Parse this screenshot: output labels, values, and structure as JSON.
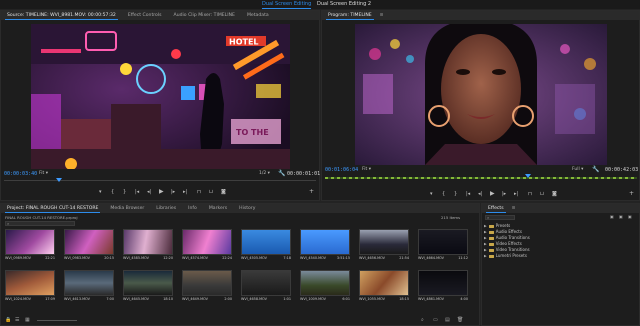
{
  "workspace_tabs": [
    "Dual Screen Editing",
    "Dual Screen Editing 2"
  ],
  "source_panel": {
    "tabs": [
      "Source: TIMELINE: WVI_8981.MOV: 00:00:57:32",
      "Effect Controls",
      "Audio Clip Mixer: TIMELINE",
      "Metadata"
    ],
    "timecode_left": "00:00:03:40",
    "timecode_right": "00:00:01:01",
    "fit_label": "Fit",
    "fraction_label": "1/2"
  },
  "program_panel": {
    "tabs": [
      "Program: TIMELINE"
    ],
    "timecode_left": "00:01:06:04",
    "timecode_right": "00:00:42:03",
    "fit_label": "Fit",
    "quality_label": "Full"
  },
  "project_panel": {
    "tabs": [
      "Project: FINAL ROUGH CUT-14 RESTORE",
      "Media Browser",
      "Libraries",
      "Info",
      "Markers",
      "History"
    ],
    "path": "FINAL ROUGH CUT-14 RESTORE.prproj",
    "items_count": "215 Items",
    "clips": [
      {
        "name": "WVI_0989.MOV",
        "dur": "22:21"
      },
      {
        "name": "WVI_0983.MOV",
        "dur": "20:15"
      },
      {
        "name": "WVI_4585.MOV",
        "dur": "12:20"
      },
      {
        "name": "WVI_4574.MOV",
        "dur": "22:24"
      },
      {
        "name": "WVI_4505.MOV",
        "dur": "7:18"
      },
      {
        "name": "WVI_4540.MOV",
        "dur": "3:51:15"
      },
      {
        "name": "WVI_4656.MOV",
        "dur": "21:54"
      },
      {
        "name": "WVI_4664.MOV",
        "dur": "11:12"
      },
      {
        "name": "WVI_1024.MOV",
        "dur": "17:09"
      },
      {
        "name": "WVI_4613.MOV",
        "dur": "7:00"
      },
      {
        "name": "WVI_4645.MOV",
        "dur": "18:10"
      },
      {
        "name": "WVI_4649.MOV",
        "dur": "2:00"
      },
      {
        "name": "WVI_4658.MOV",
        "dur": "1:01"
      },
      {
        "name": "WVI_1009.MOV",
        "dur": "6:01"
      },
      {
        "name": "WVI_1055.MOV",
        "dur": "18:15"
      },
      {
        "name": "WVI_4861.MOV",
        "dur": "4:00"
      }
    ]
  },
  "effects_panel": {
    "tab": "Effects",
    "items": [
      "Presets",
      "Audio Effects",
      "Audio Transitions",
      "Video Effects",
      "Video Transitions",
      "Lumetri Presets"
    ]
  },
  "colors": {
    "accent": "#2d8ceb",
    "timecode_blue": "#3d9bff",
    "panel_bg": "#1d1d1d"
  }
}
